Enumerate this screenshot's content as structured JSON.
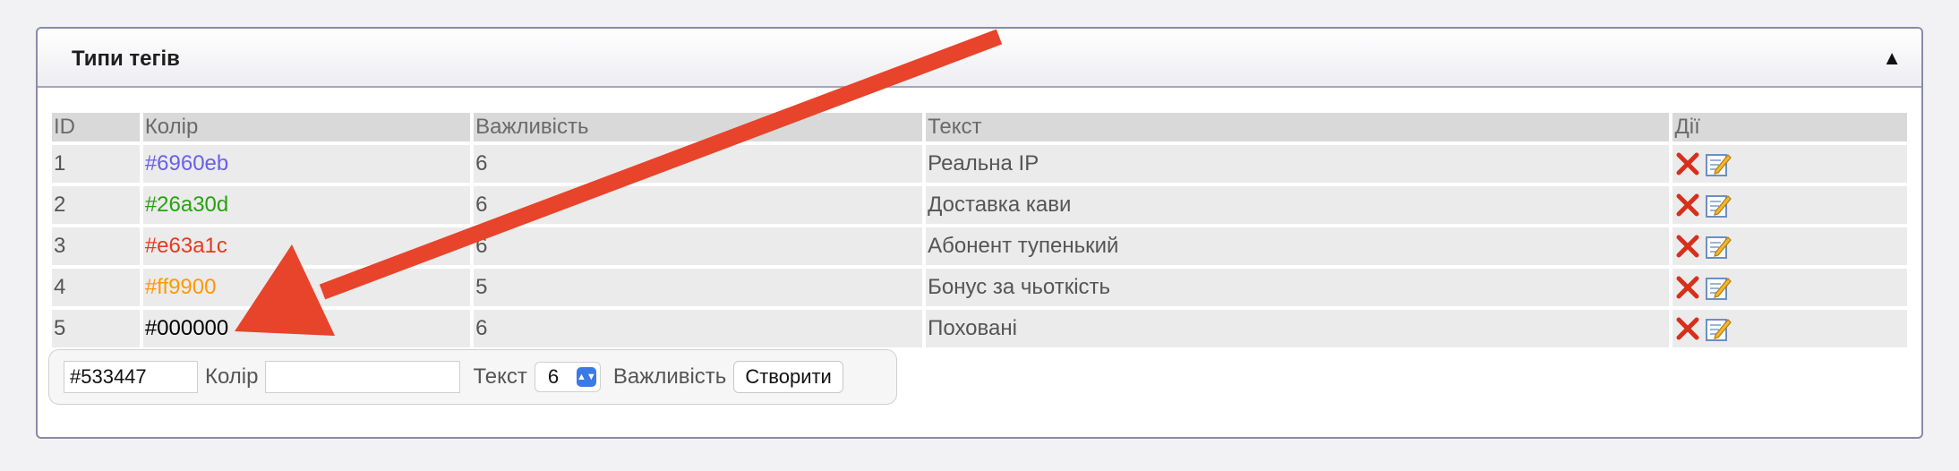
{
  "panel": {
    "title": "Типи тегів",
    "collapse_icon": "triangle-up-icon"
  },
  "table": {
    "headers": {
      "id": "ID",
      "color": "Колір",
      "importance": "Важливість",
      "text": "Текст",
      "actions": "Дії"
    },
    "rows": [
      {
        "id": "1",
        "color": "#6960eb",
        "importance": "6",
        "text": "Реальна IP"
      },
      {
        "id": "2",
        "color": "#26a30d",
        "importance": "6",
        "text": "Доставка кави"
      },
      {
        "id": "3",
        "color": "#e63a1c",
        "importance": "6",
        "text": "Абонент тупенький"
      },
      {
        "id": "4",
        "color": "#ff9900",
        "importance": "5",
        "text": "Бонус за чьоткість"
      },
      {
        "id": "5",
        "color": "#000000",
        "importance": "6",
        "text": "Поховані"
      }
    ],
    "action_icons": [
      "delete-icon",
      "edit-icon"
    ]
  },
  "form": {
    "color_value": "#533447",
    "color_label": "Колір",
    "text_value": "",
    "text_label": "Текст",
    "importance_selected": "6",
    "importance_label": "Важливість",
    "create_button": "Створити"
  },
  "colors": {
    "text_link": "#d96a2a",
    "annotation_arrow": "#e8432b"
  }
}
